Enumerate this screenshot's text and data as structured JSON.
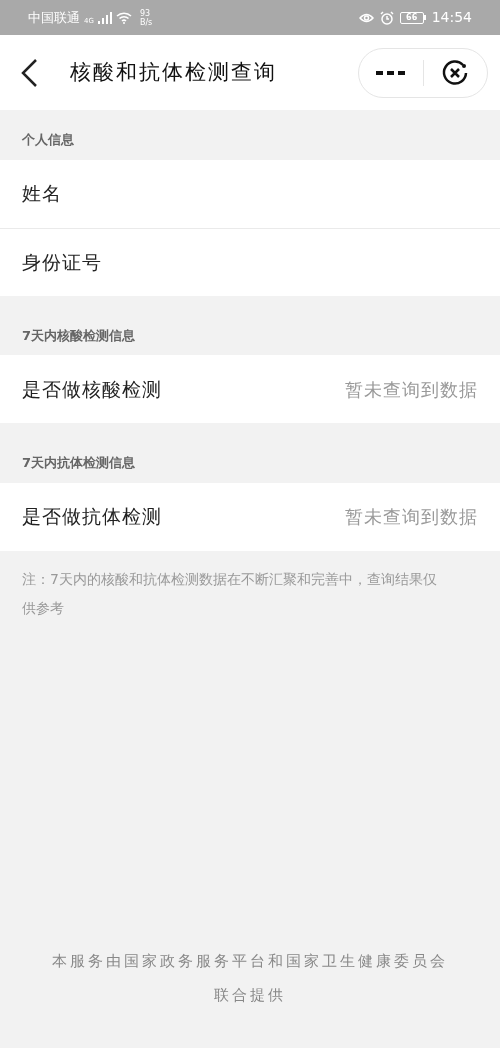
{
  "status_bar": {
    "carrier": "中国联通",
    "network": "4G",
    "speed": "93",
    "speed_unit": "B/s",
    "battery": "66",
    "time": "14:54"
  },
  "header": {
    "title": "核酸和抗体检测查询"
  },
  "sections": [
    {
      "title": "个人信息",
      "rows": [
        {
          "label": "姓名"
        },
        {
          "label": "身份证号"
        }
      ]
    },
    {
      "title": "7天内核酸检测信息",
      "rows": [
        {
          "label": "是否做核酸检测",
          "value": "暂未查询到数据"
        }
      ]
    },
    {
      "title": "7天内抗体检测信息",
      "rows": [
        {
          "label": "是否做抗体检测",
          "value": "暂未查询到数据"
        }
      ]
    }
  ],
  "note": "注：7天内的核酸和抗体检测数据在不断汇聚和完善中，查询结果仅供参考",
  "footer": "本服务由国家政务服务平台和国家卫生健康委员会联合提供"
}
